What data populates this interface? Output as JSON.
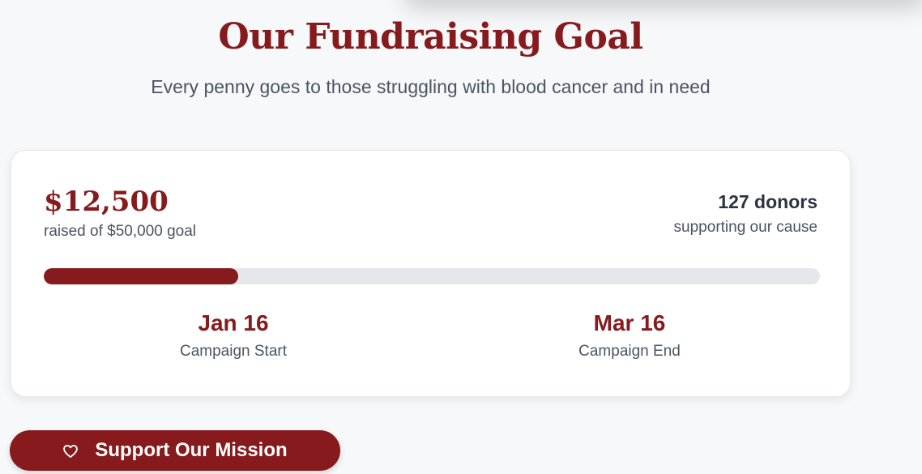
{
  "header": {
    "title": "Our Fundraising Goal",
    "subtitle": "Every penny goes to those struggling with blood cancer and in need"
  },
  "stats": {
    "raised": "$12,500",
    "goal_text": "raised of $50,000 goal",
    "donors": "127 donors",
    "donors_caption": "supporting our cause",
    "progress_fraction": 0.25
  },
  "dates": {
    "start_value": "Jan 16",
    "start_label": "Campaign Start",
    "end_value": "Mar 16",
    "end_label": "Campaign End"
  },
  "cta": {
    "label": "Support Our Mission",
    "icon": "heart-icon"
  },
  "colors": {
    "accent": "#861a1c",
    "track": "#e5e7eb",
    "background": "#f7f8fa"
  }
}
